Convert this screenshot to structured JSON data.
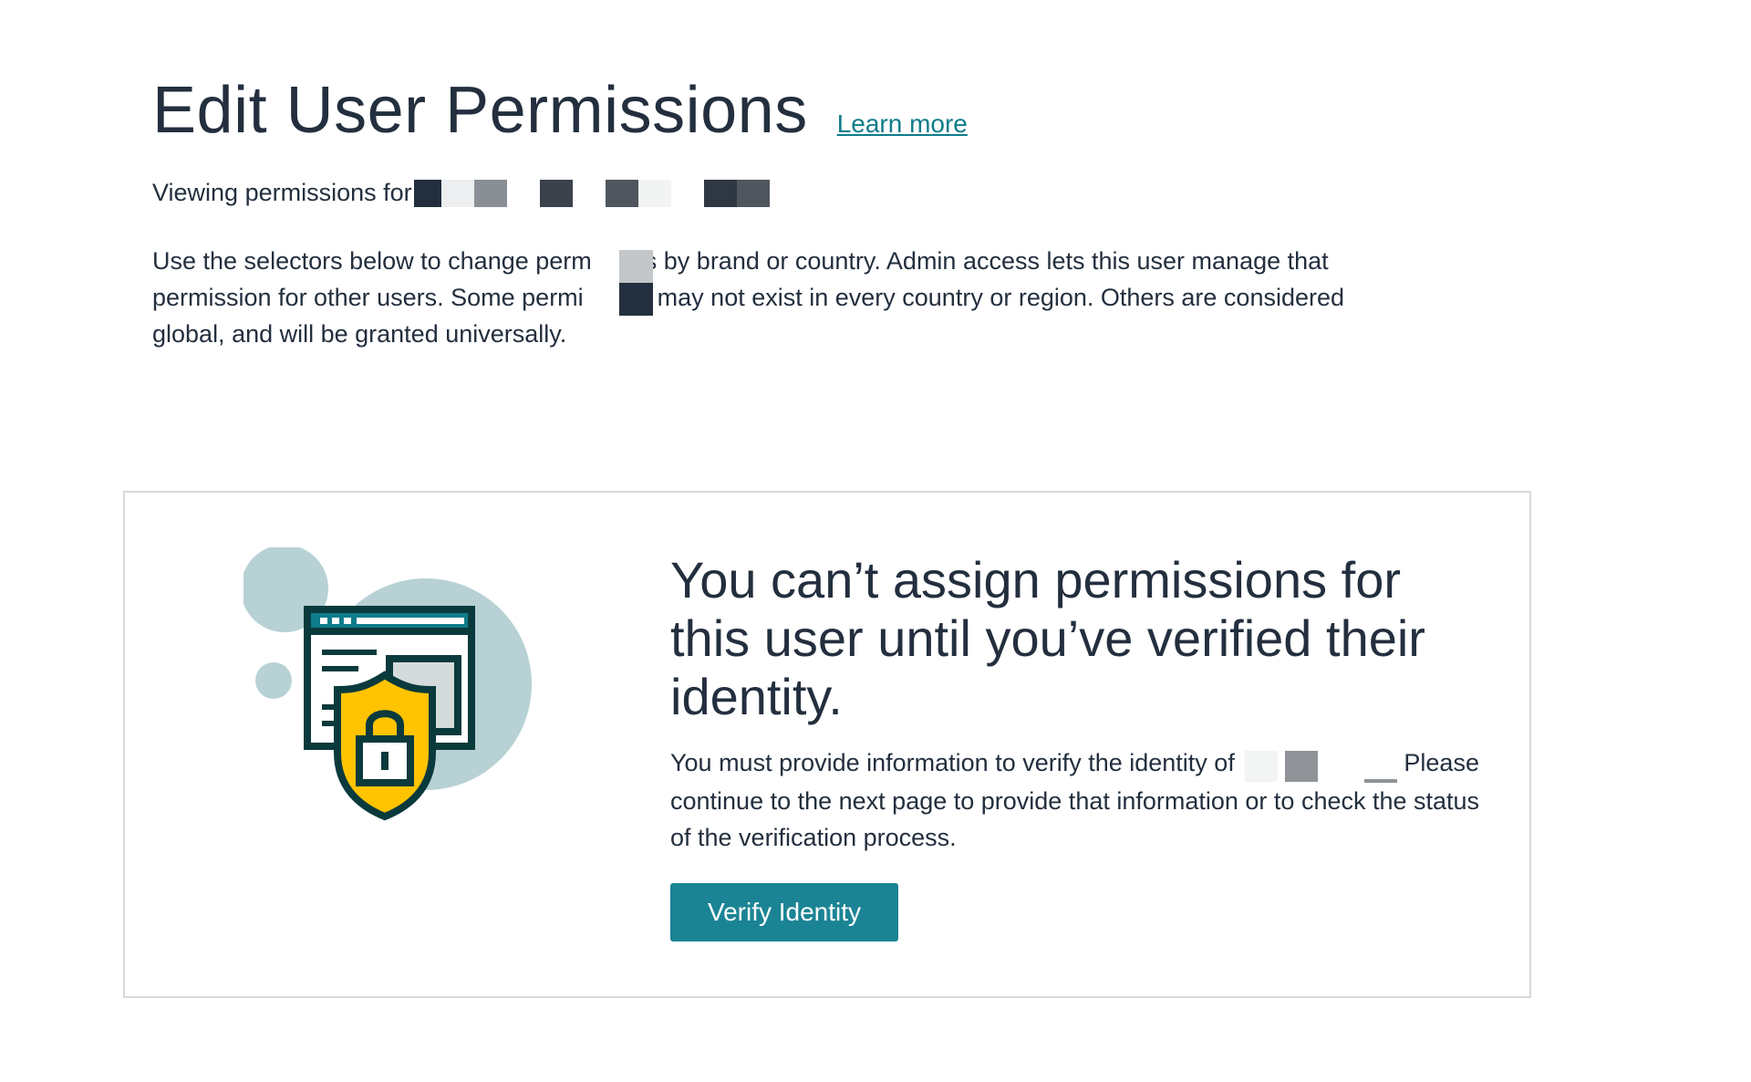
{
  "header": {
    "title": "Edit User Permissions",
    "learn_more": "Learn more"
  },
  "viewing": {
    "label": "Viewing permissions for"
  },
  "description": {
    "line1a": "Use the selectors below to change perm",
    "line1b": "ns by brand or country. Admin access lets this user manage that",
    "line2a": "permission for other users. Some permi",
    "line2b": "s may not exist in every country or region. Others are considered",
    "line3": "global, and will be granted universally."
  },
  "verification": {
    "heading": "You can’t assign permissions for this user until you’ve verified their identity.",
    "text_before": "You must provide information to verify the identity of",
    "text_after": "Please continue to the next page to provide that information or to check the status of the verification process.",
    "button_label": "Verify Identity"
  },
  "colors": {
    "title": "#232f3e",
    "link": "#0e7c8a",
    "button": "#1b8494",
    "card_border": "#d5dbdb",
    "shield": "#ffc300",
    "illustration_dark": "#0b3a3c",
    "illustration_circle": "#b7d1d5"
  },
  "icons": {
    "illustration": "shield-lock-browser-icon"
  }
}
